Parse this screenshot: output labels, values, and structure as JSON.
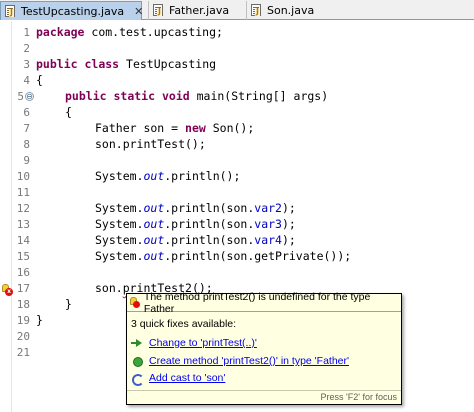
{
  "tabs": [
    {
      "label": "TestUpcasting.java",
      "close": "✕",
      "active": true
    },
    {
      "label": "Father.java",
      "active": false
    },
    {
      "label": "Son.java",
      "active": false
    }
  ],
  "line_numbers": [
    "1",
    "2",
    "3",
    "4",
    "5",
    "6",
    "7",
    "8",
    "9",
    "10",
    "11",
    "12",
    "13",
    "14",
    "15",
    "16",
    "17",
    "18",
    "19",
    "20",
    "21"
  ],
  "fold_marker": "⊖",
  "code": {
    "l1": {
      "kw": "package",
      "rest": " com.test.upcasting;"
    },
    "l3": {
      "kw1": "public",
      "sp": " ",
      "kw2": "class",
      "rest": " TestUpcasting"
    },
    "l4": "{",
    "l5": {
      "kw1": "public",
      "kw2": "static",
      "kw3": "void",
      "rest": " main(String[] args)"
    },
    "l6": "{",
    "l7": {
      "pre": "Father son = ",
      "kw": "new",
      "post": " Son();"
    },
    "l8": "son.printTest();",
    "l10": {
      "pre": "System.",
      "out": "out",
      "post": ".println();"
    },
    "l12": {
      "pre": "System.",
      "out": "out",
      "mid": ".println(son.",
      "fld": "var2",
      "post": ");"
    },
    "l13": {
      "pre": "System.",
      "out": "out",
      "mid": ".println(son.",
      "fld": "var3",
      "post": ");"
    },
    "l14": {
      "pre": "System.",
      "out": "out",
      "mid": ".println(son.",
      "fld": "var4",
      "post": ");"
    },
    "l15": {
      "pre": "System.",
      "out": "out",
      "post": ".println(son.getPrivate());"
    },
    "l17": {
      "pre": "son.",
      "err": "printTest2",
      "post": "();"
    },
    "l18": "}",
    "l19": "}"
  },
  "quickfix": {
    "error_message": "The method printTest2() is undefined for the type Father",
    "count_text": "3 quick fixes available:",
    "fixes": [
      {
        "label": "Change to 'printTest(..)'",
        "icon": "rename-arrow-icon"
      },
      {
        "label": "Create method 'printTest2()' in type 'Father'",
        "icon": "create-method-icon"
      },
      {
        "label": "Add cast to 'son'",
        "icon": "cast-icon"
      }
    ],
    "footer": "Press 'F2' for focus"
  },
  "colors": {
    "keyword": "#7f0055",
    "static_field": "#0000c0",
    "field": "#0000c0",
    "error_underline": "#ff0000",
    "popup_background": "#ffffe1",
    "active_tab": "#b9d1ea"
  }
}
